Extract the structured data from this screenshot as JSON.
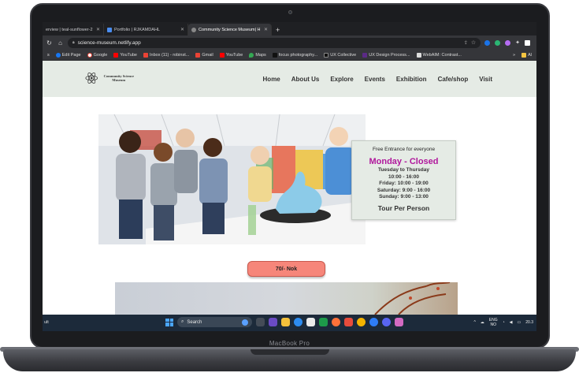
{
  "browser": {
    "tabs": [
      {
        "label": "erview | teal-sunflower-2",
        "active": false
      },
      {
        "label": "Portfolio | RJKAMDAHL",
        "active": false
      },
      {
        "label": "Community Science Museum| H",
        "active": true
      }
    ],
    "url": "science-museum.netlify.app",
    "bookmarks": [
      "Edit Page",
      "Google",
      "YouTube",
      "Inbox (11) - robinst...",
      "Gmail",
      "YouTube",
      "Maps",
      "focus photography...",
      "UX Collective",
      "UX Design Process...",
      "WebAIM: Contrast..."
    ],
    "bookmarks_more": "»",
    "bookmarks_all": "Al"
  },
  "site": {
    "logo_text": "Community Science Museum",
    "nav": [
      "Home",
      "About Us",
      "Explore",
      "Events",
      "Exhibition",
      "Cafe/shop",
      "Visit"
    ],
    "info": {
      "free_entrance": "Free Entrance for everyone",
      "closed_day": "Monday - Closed",
      "hours": [
        "Tuesday to Thursday",
        "10:00 - 16:00",
        "Friday: 10:00 - 19:00",
        "Saturday: 9:00 - 16:00",
        "Sunday: 9:00 - 13:00"
      ],
      "tour": "Tour Per Person"
    },
    "price": "70/- Nok"
  },
  "taskbar": {
    "left_text": "ult",
    "search_placeholder": "Search",
    "lang_top": "ENG",
    "lang_bottom": "NO",
    "time": "20.3"
  },
  "device": {
    "label": "MacBook Pro"
  },
  "colors": {
    "header_bg": "#e5ebe5",
    "closed_accent": "#b0179c",
    "price_button": "#f6867a"
  }
}
